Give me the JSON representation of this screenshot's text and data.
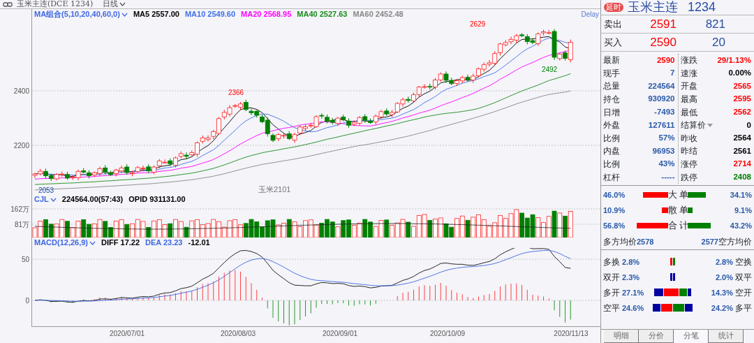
{
  "header": {
    "title": "玉米主连(DCE 1234)",
    "period": "日线"
  },
  "price_chart": {
    "legend": [
      {
        "text": "MA组合(5,10,20,40,60,0)",
        "color": "#3f67e0",
        "dropdown": true
      },
      {
        "text": "MA5 2557.00",
        "color": "#000000"
      },
      {
        "text": "MA10 2549.60",
        "color": "#4070e8"
      },
      {
        "text": "MA20 2568.95",
        "color": "#ff00ff"
      },
      {
        "text": "MA40 2527.63",
        "color": "#1a8a1a"
      },
      {
        "text": "MA60 2452.48",
        "color": "#888888"
      }
    ],
    "delay": "Delay",
    "yticks": [
      "2400",
      "2200"
    ],
    "annotations": [
      "2629",
      "2366",
      "2492",
      "2053"
    ],
    "contract_label": "玉米2101"
  },
  "volume_chart": {
    "legend": [
      {
        "text": "CJL",
        "color": "#3f67e0",
        "dropdown": true
      },
      {
        "text": "224564.00(57:43)",
        "color": "#000000"
      },
      {
        "text": "OPID 931131.00",
        "color": "#000000"
      }
    ],
    "yticks": [
      "162万",
      "81万"
    ]
  },
  "macd_chart": {
    "legend": [
      {
        "text": "MACD(12,26,9)",
        "color": "#3f67e0",
        "dropdown": true
      },
      {
        "text": "DIFF 17.22",
        "color": "#000000"
      },
      {
        "text": "DEA 23.23",
        "color": "#3f67e0"
      },
      {
        "text": "-12.01",
        "color": "#000000"
      }
    ],
    "yticks": [
      "50",
      "0"
    ]
  },
  "dates": [
    "2020/07/01",
    "2020/08/03",
    "2020/09/01",
    "2020/10/09",
    "2020/11/13"
  ],
  "quote": {
    "badge": "延时",
    "name": "玉米主连",
    "code": "1234"
  },
  "orders": [
    {
      "label": "卖出",
      "price": "2591",
      "volume": "821"
    },
    {
      "label": "买入",
      "price": "2590",
      "volume": "20"
    }
  ],
  "stats_left": [
    {
      "label": "最新",
      "value": "2590",
      "color": "#ff0000"
    },
    {
      "label": "现手",
      "value": "7",
      "color": "#2a5aa8"
    },
    {
      "label": "总量",
      "value": "224564",
      "color": "#2a5aa8"
    },
    {
      "label": "持仓",
      "value": "930920",
      "color": "#2a5aa8"
    },
    {
      "label": "日增",
      "value": "-7493",
      "color": "#2a5aa8"
    },
    {
      "label": "外盘",
      "value": "127611",
      "color": "#2a5aa8"
    },
    {
      "label": "比例",
      "value": "57%",
      "color": "#2a5aa8"
    },
    {
      "label": "内盘",
      "value": "96953",
      "color": "#2a5aa8"
    },
    {
      "label": "比例",
      "value": "43%",
      "color": "#2a5aa8"
    },
    {
      "label": "杠杆",
      "value": "-----",
      "color": "#2a5aa8"
    }
  ],
  "stats_right": [
    {
      "label": "涨跌",
      "value": "29/1.13%",
      "color": "#ff0000"
    },
    {
      "label": "速涨",
      "value": "0.00%",
      "color": "#000000"
    },
    {
      "label": "开盘",
      "value": "2565",
      "color": "#ff0000"
    },
    {
      "label": "最高",
      "value": "2595",
      "color": "#ff0000"
    },
    {
      "label": "最低",
      "value": "2562",
      "color": "#ff0000"
    },
    {
      "label": "结算价",
      "value": "0",
      "color": "#000000",
      "dropdown": true
    },
    {
      "label": "昨收",
      "value": "2564",
      "color": "#000000"
    },
    {
      "label": "昨结",
      "value": "2561",
      "color": "#000000"
    },
    {
      "label": "涨停",
      "value": "2714",
      "color": "#ff0000"
    },
    {
      "label": "跌停",
      "value": "2408",
      "color": "#008000"
    }
  ],
  "order_flow": [
    {
      "label": "大 单",
      "buy": "46.0%",
      "sell": "34.1%"
    },
    {
      "label": "散 单",
      "buy": "10.9%",
      "sell": "9.1%"
    },
    {
      "label": "合 计",
      "buy": "56.8%",
      "sell": "43.2%"
    }
  ],
  "average_prices": {
    "long_label": "多方均价",
    "long_value": "2578",
    "short_value": "2577",
    "short_label": "空方均价"
  },
  "positions": [
    {
      "left_label": "多换",
      "left_value": "2.8%",
      "right_value": "2.8%",
      "right_label": "空换",
      "segments": [
        {
          "color": "#ff0000"
        },
        {
          "color": "#008000"
        }
      ]
    },
    {
      "left_label": "双开",
      "left_value": "2.3%",
      "right_value": "2.0%",
      "right_label": "双平",
      "segments": [
        {
          "color": "#0000a0"
        },
        {
          "color": "#0000a0"
        }
      ]
    },
    {
      "left_label": "多开",
      "left_value": "27.1%",
      "right_value": "14.3%",
      "right_label": "空开",
      "segments": [
        {
          "color": "#0000a0"
        },
        {
          "color": "#ff0000"
        },
        {
          "color": "#008000"
        },
        {
          "color": "#0000a0"
        }
      ]
    },
    {
      "left_label": "空平",
      "left_value": "24.6%",
      "right_value": "24.2%",
      "right_label": "多平",
      "segments": [
        {
          "color": "#0000a0"
        },
        {
          "color": "#ff0000"
        },
        {
          "color": "#008000"
        },
        {
          "color": "#0000a0"
        }
      ]
    }
  ],
  "tabs": [
    {
      "label": "明细",
      "selected": false
    },
    {
      "label": "分价",
      "selected": false
    },
    {
      "label": "分笔",
      "selected": true
    },
    {
      "label": "统计",
      "selected": false
    }
  ]
}
